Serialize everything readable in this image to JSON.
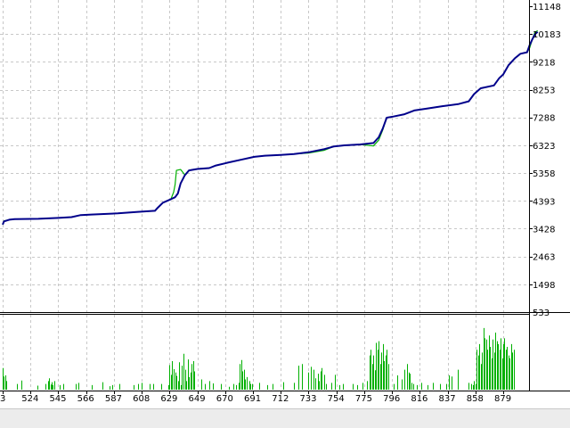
{
  "chart_data": [
    {
      "type": "line",
      "title": "",
      "xlabel": "",
      "ylabel": "",
      "grid": true,
      "legend": "none",
      "ylim": [
        533,
        11148
      ],
      "y_ticks": [
        "11148",
        "10183",
        "9218",
        "8253",
        "7288",
        "6323",
        "5358",
        "4393",
        "3428",
        "2463",
        "1498",
        "533"
      ],
      "x_ticks": [
        "3",
        "524",
        "545",
        "566",
        "587",
        "608",
        "629",
        "649",
        "670",
        "691",
        "712",
        "733",
        "754",
        "775",
        "796",
        "816",
        "837",
        "858",
        "879"
      ],
      "xlim": [
        503,
        910
      ],
      "colors": {
        "balance": "#00008b",
        "equity": "#00b000"
      },
      "series": [
        {
          "id": "balance",
          "values": [
            [
              503,
              3570
            ],
            [
              504,
              3680
            ],
            [
              508,
              3740
            ],
            [
              512,
              3760
            ],
            [
              530,
              3770
            ],
            [
              545,
              3800
            ],
            [
              555,
              3830
            ],
            [
              562,
              3900
            ],
            [
              570,
              3920
            ],
            [
              590,
              3960
            ],
            [
              605,
              4010
            ],
            [
              618,
              4050
            ],
            [
              620,
              4150
            ],
            [
              624,
              4330
            ],
            [
              630,
              4450
            ],
            [
              633,
              4520
            ],
            [
              635,
              4650
            ],
            [
              637,
              5000
            ],
            [
              640,
              5280
            ],
            [
              643,
              5450
            ],
            [
              649,
              5500
            ],
            [
              658,
              5530
            ],
            [
              663,
              5620
            ],
            [
              672,
              5720
            ],
            [
              683,
              5830
            ],
            [
              692,
              5920
            ],
            [
              700,
              5960
            ],
            [
              712,
              5990
            ],
            [
              722,
              6020
            ],
            [
              733,
              6080
            ],
            [
              745,
              6190
            ],
            [
              752,
              6280
            ],
            [
              760,
              6320
            ],
            [
              772,
              6350
            ],
            [
              782,
              6400
            ],
            [
              786,
              6600
            ],
            [
              789,
              6900
            ],
            [
              792,
              7280
            ],
            [
              797,
              7320
            ],
            [
              805,
              7400
            ],
            [
              812,
              7530
            ],
            [
              822,
              7600
            ],
            [
              833,
              7680
            ],
            [
              845,
              7750
            ],
            [
              853,
              7850
            ],
            [
              857,
              8100
            ],
            [
              862,
              8300
            ],
            [
              872,
              8400
            ],
            [
              876,
              8650
            ],
            [
              879,
              8780
            ],
            [
              883,
              9100
            ],
            [
              888,
              9350
            ],
            [
              892,
              9500
            ],
            [
              897,
              9550
            ],
            [
              899,
              9800
            ],
            [
              901,
              10000
            ],
            [
              903,
              10180
            ],
            [
              905,
              10260
            ]
          ]
        },
        {
          "id": "equity",
          "values": [
            [
              503,
              3570
            ],
            [
              504,
              3700
            ],
            [
              508,
              3740
            ],
            [
              512,
              3760
            ],
            [
              530,
              3770
            ],
            [
              545,
              3800
            ],
            [
              555,
              3830
            ],
            [
              562,
              3900
            ],
            [
              570,
              3920
            ],
            [
              590,
              3960
            ],
            [
              605,
              4010
            ],
            [
              618,
              4050
            ],
            [
              620,
              4150
            ],
            [
              624,
              4330
            ],
            [
              630,
              4450
            ],
            [
              632,
              4700
            ],
            [
              633,
              4960
            ],
            [
              634,
              5450
            ],
            [
              637,
              5480
            ],
            [
              640,
              5300
            ],
            [
              643,
              5450
            ],
            [
              649,
              5500
            ],
            [
              658,
              5530
            ],
            [
              663,
              5620
            ],
            [
              672,
              5720
            ],
            [
              683,
              5830
            ],
            [
              692,
              5920
            ],
            [
              700,
              5960
            ],
            [
              712,
              5990
            ],
            [
              722,
              6020
            ],
            [
              733,
              6050
            ],
            [
              745,
              6150
            ],
            [
              752,
              6280
            ],
            [
              760,
              6320
            ],
            [
              772,
              6350
            ],
            [
              782,
              6300
            ],
            [
              786,
              6500
            ],
            [
              789,
              6850
            ],
            [
              792,
              7280
            ],
            [
              797,
              7320
            ],
            [
              805,
              7400
            ],
            [
              812,
              7530
            ],
            [
              822,
              7600
            ],
            [
              833,
              7680
            ],
            [
              845,
              7750
            ],
            [
              853,
              7850
            ],
            [
              857,
              8100
            ],
            [
              862,
              8300
            ],
            [
              872,
              8400
            ],
            [
              876,
              8650
            ],
            [
              879,
              8780
            ],
            [
              883,
              9100
            ],
            [
              888,
              9350
            ],
            [
              892,
              9500
            ],
            [
              897,
              9550
            ],
            [
              899,
              9700
            ],
            [
              901,
              10000
            ],
            [
              903,
              10250
            ],
            [
              905,
              10300
            ]
          ]
        }
      ]
    },
    {
      "type": "bar",
      "title": "",
      "xlabel": "",
      "ylabel": "",
      "grid": true,
      "legend": "none",
      "ylim": [
        0,
        100
      ],
      "colors": {
        "bars": "#00b000"
      },
      "series": [
        {
          "id": "volume",
          "x": [
            503,
            504,
            505,
            506,
            514,
            517,
            529,
            535,
            537,
            538,
            539,
            540,
            541,
            542,
            546,
            549,
            558,
            560,
            570,
            578,
            584,
            586,
            591,
            602,
            605,
            608,
            614,
            617,
            623,
            628,
            629,
            630,
            631,
            632,
            633,
            634,
            635,
            636,
            637,
            638,
            639,
            640,
            641,
            642,
            643,
            644,
            645,
            646,
            647,
            652,
            655,
            658,
            661,
            667,
            673,
            676,
            678,
            680,
            681,
            682,
            683,
            684,
            685,
            686,
            688,
            689,
            690,
            696,
            702,
            706,
            714,
            722,
            725,
            728,
            733,
            735,
            737,
            738,
            740,
            741,
            742,
            743,
            745,
            746,
            750,
            753,
            756,
            759,
            766,
            770,
            774,
            777,
            779,
            780,
            781,
            782,
            783,
            784,
            785,
            786,
            787,
            788,
            789,
            790,
            791,
            792,
            793,
            797,
            800,
            803,
            805,
            807,
            808,
            809,
            810,
            811,
            814,
            817,
            822,
            826,
            831,
            836,
            838,
            840,
            845,
            853,
            855,
            856,
            857,
            858,
            859,
            860,
            861,
            862,
            863,
            864,
            865,
            866,
            867,
            868,
            869,
            870,
            871,
            872,
            873,
            874,
            875,
            876,
            877,
            878,
            879,
            880,
            881,
            882,
            883,
            884,
            885,
            886,
            887
          ],
          "values": [
            38,
            23,
            25,
            15,
            10,
            16,
            7,
            10,
            15,
            20,
            9,
            13,
            8,
            15,
            8,
            10,
            10,
            12,
            8,
            13,
            6,
            8,
            10,
            8,
            10,
            12,
            10,
            10,
            10,
            8,
            43,
            26,
            50,
            36,
            30,
            24,
            15,
            48,
            8,
            42,
            63,
            35,
            15,
            53,
            22,
            30,
            45,
            50,
            32,
            18,
            10,
            15,
            11,
            10,
            5,
            10,
            8,
            12,
            45,
            52,
            32,
            35,
            18,
            22,
            15,
            10,
            10,
            12,
            8,
            10,
            13,
            12,
            42,
            45,
            30,
            40,
            35,
            20,
            28,
            15,
            32,
            38,
            26,
            10,
            12,
            26,
            8,
            10,
            10,
            8,
            12,
            15,
            60,
            70,
            45,
            60,
            34,
            82,
            70,
            85,
            45,
            65,
            80,
            50,
            60,
            70,
            45,
            10,
            25,
            18,
            35,
            45,
            30,
            28,
            12,
            10,
            8,
            12,
            8,
            12,
            10,
            10,
            25,
            23,
            35,
            12,
            10,
            8,
            15,
            10,
            70,
            60,
            80,
            45,
            65,
            108,
            90,
            88,
            70,
            95,
            75,
            55,
            88,
            65,
            100,
            85,
            80,
            70,
            90,
            55,
            80,
            90,
            70,
            75,
            60,
            55,
            80,
            65,
            70
          ]
        }
      ]
    }
  ]
}
